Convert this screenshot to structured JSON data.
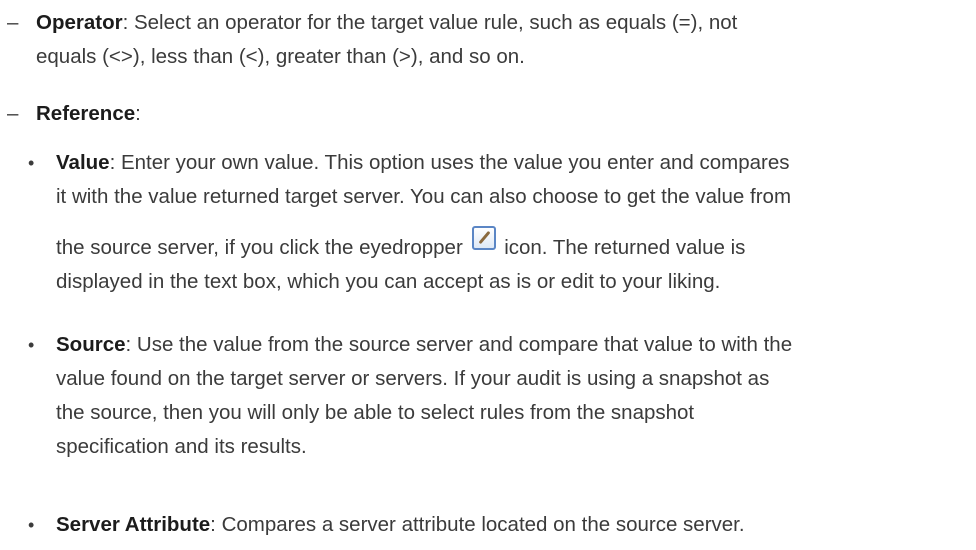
{
  "operator": {
    "term": "Operator",
    "line1": ": Select an operator for the target value rule, such as equals (=), not",
    "line2": "equals (<>), less than (<), greater than (>), and so on."
  },
  "reference": {
    "term": "Reference",
    "suffix": ":"
  },
  "value": {
    "term": "Value",
    "line1": ": Enter your own value. This option uses the value you enter and compares",
    "line2": "it with the value returned target server. You can also choose to get the value from",
    "line3a": "the source server, if you click the eyedropper",
    "line3b": "icon. The returned value is",
    "line4": "displayed in the text box, which you can accept as is or edit to your liking.",
    "icon": "eyedropper-icon"
  },
  "source": {
    "term": "Source",
    "line1": ": Use the value from the source server and compare that value to with the",
    "line2": "value found on the target server or servers. If your audit is using a snapshot as",
    "line3": "the source, then you will only be able to select rules from the snapshot",
    "line4": "specification and its results."
  },
  "server_attribute": {
    "term": "Server Attribute",
    "line1": ": Compares a server attribute located on the source server."
  },
  "markers": {
    "dash": "–",
    "bullet": "•"
  }
}
